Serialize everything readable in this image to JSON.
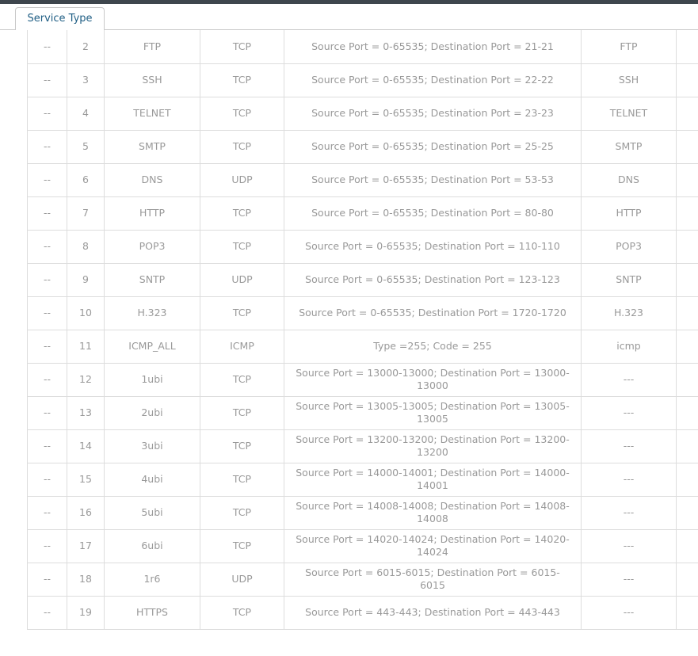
{
  "tab": {
    "label": "Service Type"
  },
  "rows": [
    {
      "select": "--",
      "id": "2",
      "name": "FTP",
      "protocol": "TCP",
      "detail": "Source Port = 0-65535; Destination Port = 21-21",
      "extra": "FTP"
    },
    {
      "select": "--",
      "id": "3",
      "name": "SSH",
      "protocol": "TCP",
      "detail": "Source Port = 0-65535; Destination Port = 22-22",
      "extra": "SSH"
    },
    {
      "select": "--",
      "id": "4",
      "name": "TELNET",
      "protocol": "TCP",
      "detail": "Source Port = 0-65535; Destination Port = 23-23",
      "extra": "TELNET"
    },
    {
      "select": "--",
      "id": "5",
      "name": "SMTP",
      "protocol": "TCP",
      "detail": "Source Port = 0-65535; Destination Port = 25-25",
      "extra": "SMTP"
    },
    {
      "select": "--",
      "id": "6",
      "name": "DNS",
      "protocol": "UDP",
      "detail": "Source Port = 0-65535; Destination Port = 53-53",
      "extra": "DNS"
    },
    {
      "select": "--",
      "id": "7",
      "name": "HTTP",
      "protocol": "TCP",
      "detail": "Source Port = 0-65535; Destination Port = 80-80",
      "extra": "HTTP"
    },
    {
      "select": "--",
      "id": "8",
      "name": "POP3",
      "protocol": "TCP",
      "detail": "Source Port = 0-65535; Destination Port = 110-110",
      "extra": "POP3"
    },
    {
      "select": "--",
      "id": "9",
      "name": "SNTP",
      "protocol": "UDP",
      "detail": "Source Port = 0-65535; Destination Port = 123-123",
      "extra": "SNTP"
    },
    {
      "select": "--",
      "id": "10",
      "name": "H.323",
      "protocol": "TCP",
      "detail": "Source Port = 0-65535; Destination Port = 1720-1720",
      "extra": "H.323"
    },
    {
      "select": "--",
      "id": "11",
      "name": "ICMP_ALL",
      "protocol": "ICMP",
      "detail": "Type =255; Code = 255",
      "extra": "icmp"
    },
    {
      "select": "--",
      "id": "12",
      "name": "1ubi",
      "protocol": "TCP",
      "detail": "Source Port = 13000-13000; Destination Port = 13000-13000",
      "extra": "---"
    },
    {
      "select": "--",
      "id": "13",
      "name": "2ubi",
      "protocol": "TCP",
      "detail": "Source Port = 13005-13005; Destination Port = 13005-13005",
      "extra": "---"
    },
    {
      "select": "--",
      "id": "14",
      "name": "3ubi",
      "protocol": "TCP",
      "detail": "Source Port = 13200-13200; Destination Port = 13200-13200",
      "extra": "---"
    },
    {
      "select": "--",
      "id": "15",
      "name": "4ubi",
      "protocol": "TCP",
      "detail": "Source Port = 14000-14001; Destination Port = 14000-14001",
      "extra": "---"
    },
    {
      "select": "--",
      "id": "16",
      "name": "5ubi",
      "protocol": "TCP",
      "detail": "Source Port = 14008-14008; Destination Port = 14008-14008",
      "extra": "---"
    },
    {
      "select": "--",
      "id": "17",
      "name": "6ubi",
      "protocol": "TCP",
      "detail": "Source Port = 14020-14024; Destination Port = 14020-14024",
      "extra": "---"
    },
    {
      "select": "--",
      "id": "18",
      "name": "1r6",
      "protocol": "UDP",
      "detail": "Source Port = 6015-6015; Destination Port = 6015-6015",
      "extra": "---"
    },
    {
      "select": "--",
      "id": "19",
      "name": "HTTPS",
      "protocol": "TCP",
      "detail": "Source Port = 443-443; Destination Port = 443-443",
      "extra": "---"
    }
  ]
}
